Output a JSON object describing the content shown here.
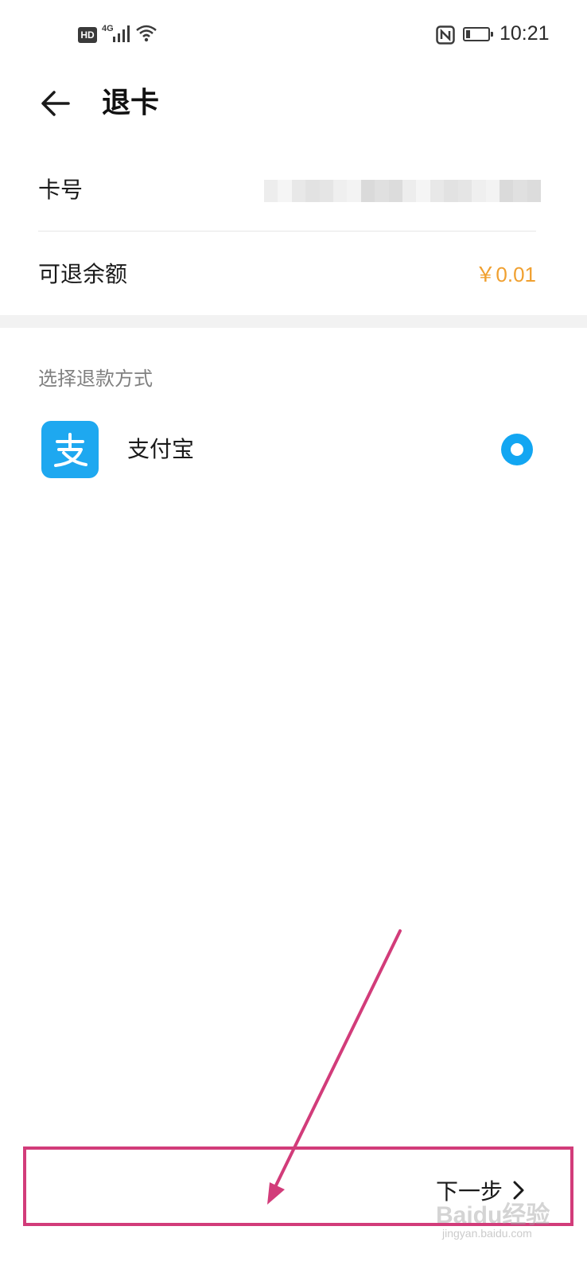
{
  "status_bar": {
    "hd": "HD",
    "network": "4G",
    "time": "10:21",
    "icons": [
      "hd-icon",
      "signal-icon",
      "wifi-icon",
      "nfc-icon",
      "battery-icon"
    ],
    "battery_level": 0.2
  },
  "header": {
    "title": "退卡",
    "back_icon": "arrow-left-icon"
  },
  "card_info": {
    "card_label": "卡号",
    "card_number_masked": true,
    "balance_label": "可退余额",
    "balance_value": "￥0.01",
    "balance_color": "#f0a030"
  },
  "refund": {
    "section_title": "选择退款方式",
    "methods": [
      {
        "label": "支付宝",
        "icon": "alipay-icon",
        "icon_color": "#1ea8f0",
        "selected": true
      }
    ],
    "radio_color": "#12a6f2"
  },
  "footer": {
    "next_label": "下一步",
    "next_icon": "chevron-right-icon"
  },
  "annotation": {
    "highlight_color": "#d23c7a",
    "watermark": "Baidu经验",
    "watermark_sub": "jingyan.baidu.com"
  }
}
